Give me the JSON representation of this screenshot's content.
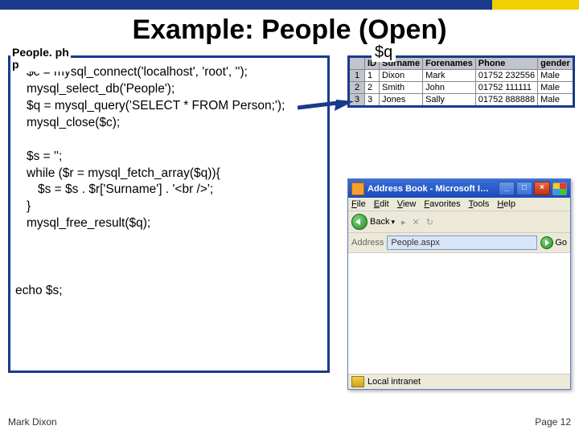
{
  "title": "Example: People (Open)",
  "file_label_line1": "People. ph",
  "file_label_line2": "p",
  "q_label": "$q",
  "code": {
    "l1": "$c = mysql_connect('localhost', 'root', '');",
    "l2": "mysql_select_db('People');",
    "l3": "$q = mysql_query('SELECT * FROM Person;');",
    "l4": "mysql_close($c);",
    "l5": "$s = '';",
    "l6": "while ($r = mysql_fetch_array($q)){",
    "l7": "$s = $s . $r['Surname'] . '<br />';",
    "l8": "}",
    "l9": "mysql_free_result($q);",
    "l10": "echo $s;"
  },
  "table": {
    "headers": [
      "ID",
      "Surname",
      "Forenames",
      "Phone",
      "gender"
    ],
    "rows": [
      {
        "n": "1",
        "c": [
          "1",
          "Dixon",
          "Mark",
          "01752 232556",
          "Male"
        ]
      },
      {
        "n": "2",
        "c": [
          "2",
          "Smith",
          "John",
          "01752 111111",
          "Male"
        ]
      },
      {
        "n": "3",
        "c": [
          "3",
          "Jones",
          "Sally",
          "01752 888888",
          "Male"
        ]
      }
    ]
  },
  "browser": {
    "title": "Address Book - Microsoft I…",
    "menus": [
      "File",
      "Edit",
      "View",
      "Favorites",
      "Tools",
      "Help"
    ],
    "back": "Back",
    "addr_label": "Address",
    "addr_value": "People.aspx",
    "go": "Go",
    "status": "Local intranet"
  },
  "footer": {
    "left": "Mark Dixon",
    "right": "Page 12"
  }
}
